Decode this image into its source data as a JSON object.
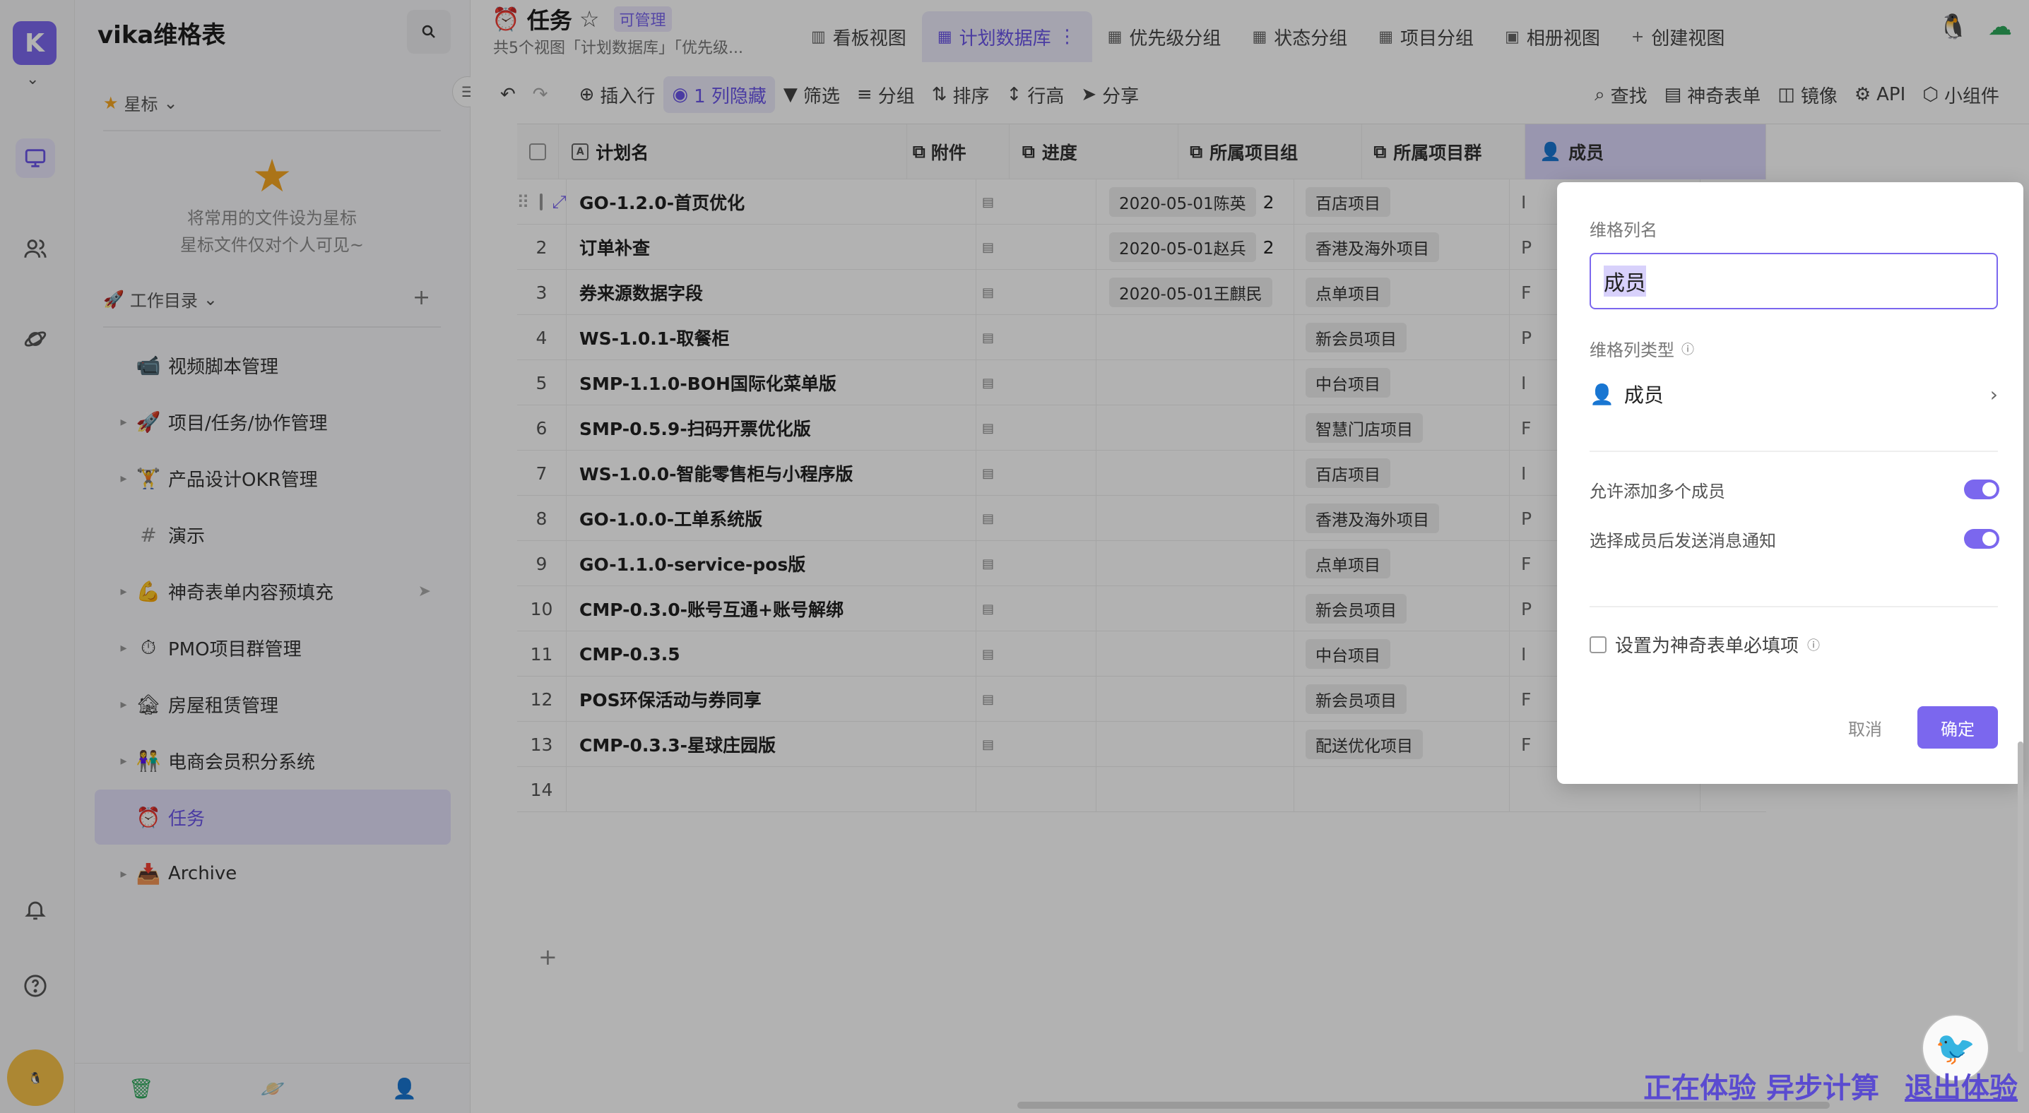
{
  "rail": {
    "logo_text": "K",
    "icons": [
      "desktop-icon",
      "people-icon",
      "planet-icon",
      "bell-icon",
      "help-icon"
    ]
  },
  "sidebar": {
    "title": "vika维格表",
    "starred_label": "星标",
    "starred_hint_1": "将常用的文件设为星标",
    "starred_hint_2": "星标文件仅对个人可见~",
    "workdir_label": "工作目录",
    "items": [
      {
        "label": "视频脚本管理",
        "emoji": "📹",
        "arrow": false
      },
      {
        "label": "项目/任务/协作管理",
        "emoji": "🚀",
        "arrow": true
      },
      {
        "label": "产品设计OKR管理",
        "emoji": "🏋",
        "arrow": true
      },
      {
        "label": "演示",
        "emoji": "#",
        "arrow": false
      },
      {
        "label": "神奇表单内容预填充",
        "emoji": "💪",
        "arrow": true
      },
      {
        "label": "PMO项目群管理",
        "emoji": "⏱",
        "arrow": true
      },
      {
        "label": "房屋租赁管理",
        "emoji": "🏚",
        "arrow": true
      },
      {
        "label": "电商会员积分系统",
        "emoji": "👫",
        "arrow": true
      },
      {
        "label": "任务",
        "emoji": "⏰",
        "arrow": false
      },
      {
        "label": "Archive",
        "emoji": "📥",
        "arrow": true
      }
    ]
  },
  "header": {
    "title": "任务",
    "badge": "可管理",
    "subtitle": "共5个视图「计划数据库」「优先级...",
    "tabs": [
      {
        "label": "看板视图",
        "icon": "kanban-icon"
      },
      {
        "label": "计划数据库",
        "icon": "grid-icon",
        "active": true
      },
      {
        "label": "优先级分组",
        "icon": "grid-icon"
      },
      {
        "label": "状态分组",
        "icon": "grid-icon"
      },
      {
        "label": "项目分组",
        "icon": "grid-icon"
      },
      {
        "label": "相册视图",
        "icon": "gallery-icon"
      },
      {
        "label": "创建视图",
        "icon": "plus-icon"
      }
    ]
  },
  "toolbar": {
    "insert_row": "插入行",
    "hidden_cols": "1 列隐藏",
    "filter": "筛选",
    "group": "分组",
    "sort": "排序",
    "row_height": "行高",
    "share": "分享",
    "find": "查找",
    "form": "神奇表单",
    "mirror": "镜像",
    "api": "API",
    "widget": "小组件"
  },
  "grid": {
    "columns": {
      "name": "计划名",
      "attachment": "附件",
      "progress": "进度",
      "group": "所属项目组",
      "cluster": "所属项目群",
      "member": "成员"
    },
    "rows": [
      {
        "idx": "",
        "name": "GO-1.2.0-首页优化",
        "progress": "2020-05-01陈英",
        "progress2": "2",
        "group": "百店项目",
        "cluster": "I"
      },
      {
        "idx": "2",
        "name": "订单补查",
        "progress": "2020-05-01赵兵",
        "progress2": "2",
        "group": "香港及海外项目",
        "cluster": "P"
      },
      {
        "idx": "3",
        "name": "券来源数据字段",
        "progress": "2020-05-01王麒民",
        "progress2": "",
        "group": "点单项目",
        "cluster": "F"
      },
      {
        "idx": "4",
        "name": "WS-1.0.1-取餐柜",
        "progress": "",
        "progress2": "",
        "group": "新会员项目",
        "cluster": "P"
      },
      {
        "idx": "5",
        "name": "SMP-1.1.0-BOH国际化菜单版",
        "progress": "",
        "progress2": "",
        "group": "中台项目",
        "cluster": "I"
      },
      {
        "idx": "6",
        "name": "SMP-0.5.9-扫码开票优化版",
        "progress": "",
        "progress2": "",
        "group": "智慧门店项目",
        "cluster": "F"
      },
      {
        "idx": "7",
        "name": "WS-1.0.0-智能零售柜与小程序版",
        "progress": "",
        "progress2": "",
        "group": "百店项目",
        "cluster": "I"
      },
      {
        "idx": "8",
        "name": "GO-1.0.0-工单系统版",
        "progress": "",
        "progress2": "",
        "group": "香港及海外项目",
        "cluster": "P"
      },
      {
        "idx": "9",
        "name": "GO-1.1.0-service-pos版",
        "progress": "",
        "progress2": "",
        "group": "点单项目",
        "cluster": "F"
      },
      {
        "idx": "10",
        "name": "CMP-0.3.0-账号互通+账号解绑",
        "progress": "",
        "progress2": "",
        "group": "新会员项目",
        "cluster": "P"
      },
      {
        "idx": "11",
        "name": "CMP-0.3.5",
        "progress": "",
        "progress2": "",
        "group": "中台项目",
        "cluster": "I"
      },
      {
        "idx": "12",
        "name": "POS环保活动与券同享",
        "progress": "",
        "progress2": "",
        "group": "新会员项目",
        "cluster": "F"
      },
      {
        "idx": "13",
        "name": "CMP-0.3.3-星球庄园版",
        "progress": "",
        "progress2": "",
        "group": "配送优化项目",
        "cluster": "F"
      },
      {
        "idx": "14",
        "name": "",
        "progress": "",
        "progress2": "",
        "group": "",
        "cluster": ""
      }
    ],
    "add_row": "+"
  },
  "panel": {
    "col_name_label": "维格列名",
    "col_name_value": "成员",
    "col_type_label": "维格列类型",
    "col_type_value": "成员",
    "allow_multiple": "允许添加多个成员",
    "notify": "选择成员后发送消息通知",
    "required_form": "设置为神奇表单必填项",
    "cancel": "取消",
    "confirm": "确定"
  },
  "footer": {
    "experience": "正在体验 异步计算",
    "exit": "退出体验"
  },
  "colors": {
    "accent": "#7b67ee",
    "active_bg": "#e3e0fa",
    "overlay": "rgba(0,0,0,0.30)"
  }
}
